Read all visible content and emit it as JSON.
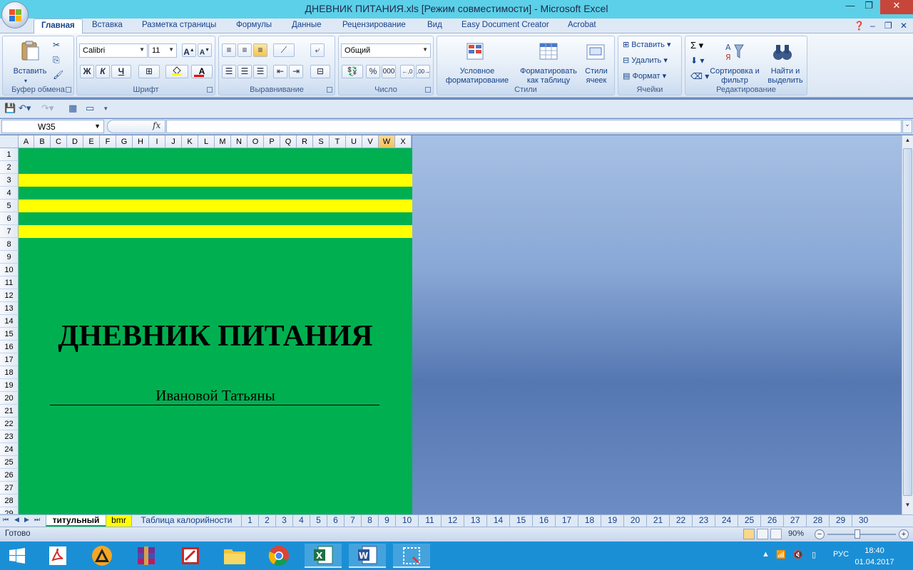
{
  "window": {
    "title": "ДНЕВНИК ПИТАНИЯ.xls  [Режим совместимости] - Microsoft Excel"
  },
  "ribbon_tabs": [
    {
      "label": "Главная",
      "active": true
    },
    {
      "label": "Вставка"
    },
    {
      "label": "Разметка страницы"
    },
    {
      "label": "Формулы"
    },
    {
      "label": "Данные"
    },
    {
      "label": "Рецензирование"
    },
    {
      "label": "Вид"
    },
    {
      "label": "Easy Document Creator"
    },
    {
      "label": "Acrobat"
    }
  ],
  "ribbon": {
    "clipboard": {
      "label": "Буфер обмена",
      "paste": "Вставить"
    },
    "font": {
      "label": "Шрифт",
      "name": "Calibri",
      "size": "11",
      "bold": "Ж",
      "italic": "К",
      "underline": "Ч"
    },
    "alignment": {
      "label": "Выравнивание"
    },
    "number": {
      "label": "Число",
      "format": "Общий",
      "percent": "%",
      "thousands": "000"
    },
    "styles": {
      "label": "Стили",
      "conditional": "Условное форматирование",
      "format_table": "Форматировать как таблицу",
      "cell_styles": "Стили ячеек"
    },
    "cells": {
      "label": "Ячейки",
      "insert": "Вставить",
      "delete": "Удалить",
      "format": "Формат"
    },
    "editing": {
      "label": "Редактирование",
      "sort": "Сортировка и фильтр",
      "find": "Найти и выделить"
    }
  },
  "formula_bar": {
    "name_box": "W35",
    "fx": "fx",
    "value": ""
  },
  "columns": [
    "A",
    "B",
    "C",
    "D",
    "E",
    "F",
    "G",
    "H",
    "I",
    "J",
    "K",
    "L",
    "M",
    "N",
    "O",
    "P",
    "Q",
    "R",
    "S",
    "T",
    "U",
    "V",
    "W",
    "X"
  ],
  "selected_column": "W",
  "rows": [
    "1",
    "2",
    "3",
    "4",
    "5",
    "6",
    "7",
    "8",
    "9",
    "10",
    "11",
    "12",
    "13",
    "14",
    "15",
    "16",
    "17",
    "18",
    "19",
    "20",
    "21",
    "22",
    "23",
    "24",
    "25",
    "26",
    "27",
    "28",
    "29"
  ],
  "sheet_content": {
    "title": "ДНЕВНИК ПИТАНИЯ",
    "name": "Ивановой Татьяны",
    "background_color": "#00b050",
    "stripe_color": "#ffff00"
  },
  "sheet_tabs": [
    {
      "label": "титульный",
      "active": true
    },
    {
      "label": "bmr",
      "highlight": true
    },
    {
      "label": "Таблица калорийности"
    },
    {
      "label": "1"
    },
    {
      "label": "2"
    },
    {
      "label": "3"
    },
    {
      "label": "4"
    },
    {
      "label": "5"
    },
    {
      "label": "6"
    },
    {
      "label": "7"
    },
    {
      "label": "8"
    },
    {
      "label": "9"
    },
    {
      "label": "10"
    },
    {
      "label": "11"
    },
    {
      "label": "12"
    },
    {
      "label": "13"
    },
    {
      "label": "14"
    },
    {
      "label": "15"
    },
    {
      "label": "16"
    },
    {
      "label": "17"
    },
    {
      "label": "18"
    },
    {
      "label": "19"
    },
    {
      "label": "20"
    },
    {
      "label": "21"
    },
    {
      "label": "22"
    },
    {
      "label": "23"
    },
    {
      "label": "24"
    },
    {
      "label": "25"
    },
    {
      "label": "26"
    },
    {
      "label": "27"
    },
    {
      "label": "28"
    },
    {
      "label": "29"
    },
    {
      "label": "30"
    }
  ],
  "status": {
    "ready": "Готово",
    "zoom": "90%"
  },
  "taskbar": {
    "lang": "РУС",
    "time": "18:40",
    "date": "01.04.2017",
    "apps": [
      "windows-start",
      "acrobat",
      "avast",
      "winrar",
      "pdf-tool",
      "explorer",
      "chrome",
      "excel",
      "word",
      "snipping"
    ]
  }
}
